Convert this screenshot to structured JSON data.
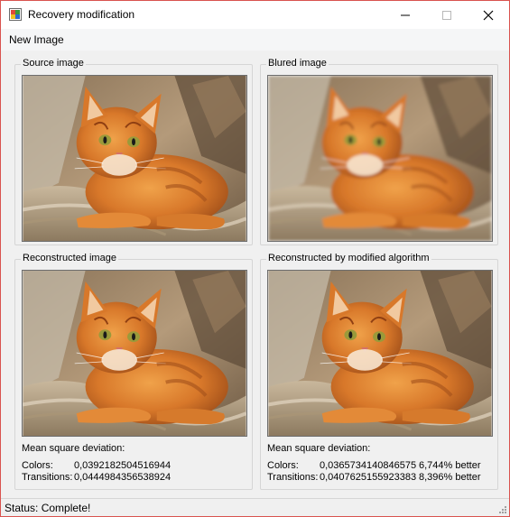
{
  "window": {
    "title": "Recovery modification",
    "icon": "app-window-icon",
    "buttons": [
      "minimize-icon",
      "maximize-icon",
      "close-icon"
    ]
  },
  "menu": {
    "items": [
      {
        "label": "New Image"
      }
    ]
  },
  "panels": {
    "source": {
      "label": "Source image",
      "image": "orange tabby cat lying on a cat bed"
    },
    "blurred": {
      "label": "Blured image",
      "image": "blurred version of the cat photo"
    },
    "reconstructed": {
      "label": "Reconstructed image",
      "image": "reconstructed cat photo"
    },
    "modified": {
      "label": "Reconstructed by modified algorithm",
      "image": "reconstructed cat photo (modified algorithm)"
    }
  },
  "stats": {
    "heading": "Mean square deviation:",
    "colors_label": "Colors:",
    "transitions_label": "Transitions:",
    "reconstructed": {
      "colors": "0,0392182504516944",
      "transitions": "0,0444984356538924"
    },
    "modified": {
      "colors": "0,0365734140846575",
      "transitions": "0,0407625155923383",
      "colors_improvement": "6,744% better",
      "transitions_improvement": "8,396% better"
    }
  },
  "status": {
    "text": "Status: Complete!"
  },
  "colors": {
    "window_border": "#d9534f",
    "background": "#f0f0f0"
  }
}
